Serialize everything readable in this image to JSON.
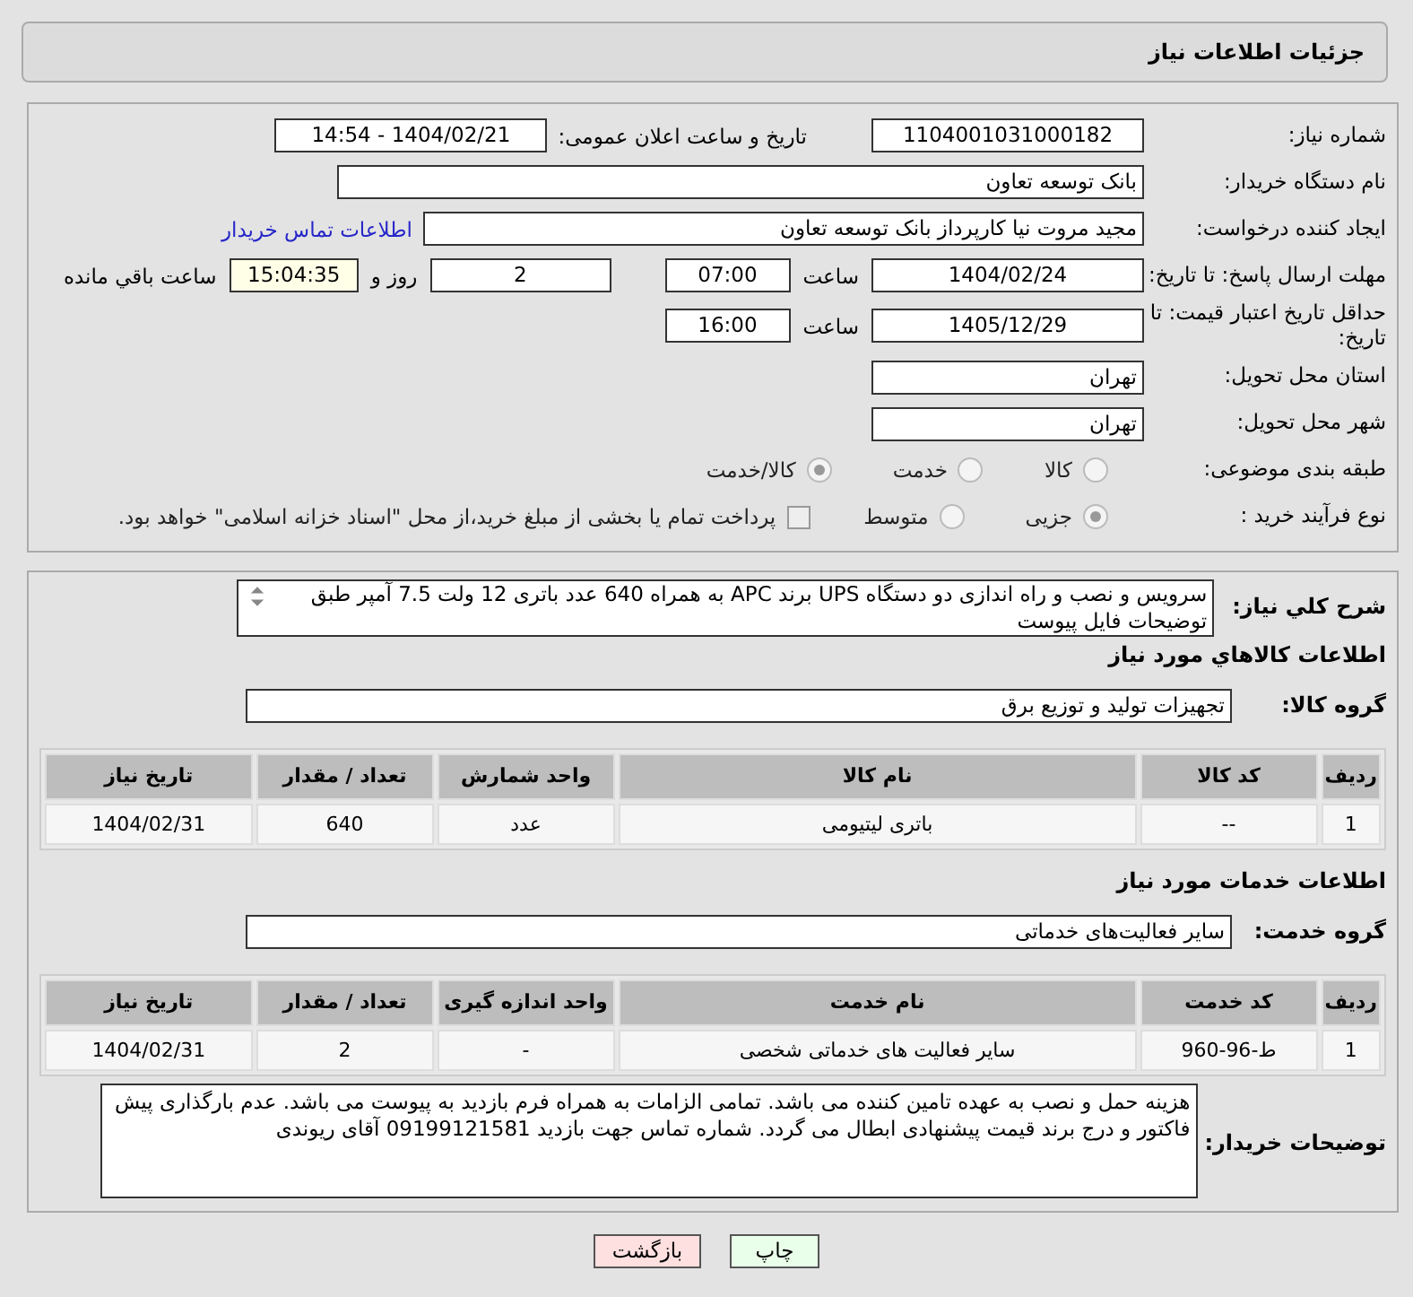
{
  "header": {
    "title": "جزئیات اطلاعات نیاز"
  },
  "form": {
    "need_number": {
      "label": "شماره نیاز:",
      "value": "1104001031000182"
    },
    "announce": {
      "label": "تاریخ و ساعت اعلان عمومی:",
      "value": "1404/02/21 - 14:54"
    },
    "buyer_org": {
      "label": "نام دستگاه خریدار:",
      "value": "بانک توسعه تعاون"
    },
    "requester": {
      "label": "ایجاد کننده درخواست:",
      "value": "مجید مروت نیا کارپرداز بانک توسعه تعاون",
      "link": "اطلاعات تماس خریدار"
    },
    "deadline": {
      "label": "مهلت ارسال پاسخ: تا تاریخ:",
      "date": "1404/02/24",
      "time_label": "ساعت",
      "time": "07:00",
      "days": "2",
      "days_label": "روز و",
      "remaining": "15:04:35",
      "remaining_label": "ساعت باقي مانده"
    },
    "validity": {
      "label": "حداقل تاریخ اعتبار قیمت: تا تاریخ:",
      "date": "1405/12/29",
      "time_label": "ساعت",
      "time": "16:00"
    },
    "province": {
      "label": "استان محل تحویل:",
      "value": "تهران"
    },
    "city": {
      "label": "شهر محل تحویل:",
      "value": "تهران"
    },
    "category": {
      "label": "طبقه بندی موضوعی:",
      "options": [
        {
          "label": "کالا",
          "selected": false
        },
        {
          "label": "خدمت",
          "selected": false
        },
        {
          "label": "کالا/خدمت",
          "selected": true
        }
      ]
    },
    "process": {
      "label": "نوع فرآیند خرید :",
      "options": [
        {
          "label": "جزیی",
          "selected": true
        },
        {
          "label": "متوسط",
          "selected": false
        }
      ],
      "payment": {
        "label": "پرداخت تمام یا بخشی از مبلغ خرید،از محل \"اسناد خزانه اسلامی\" خواهد بود.",
        "checked": false
      }
    }
  },
  "details": {
    "description": {
      "label": "شرح کلي نیاز:",
      "value": "سرویس و نصب و راه اندازی دو دستگاه UPS برند APC به همراه 640 عدد باتری 12 ولت 7.5 آمپر طبق توضیحات فایل پیوست"
    },
    "goods": {
      "heading": "اطلاعات کالاهاي مورد نیاز",
      "group_label": "گروه کالا:",
      "group": "تجهیزات تولید و توزیع برق",
      "columns": [
        "ردیف",
        "کد کالا",
        "نام کالا",
        "واحد شمارش",
        "تعداد / مقدار",
        "تاریخ نیاز"
      ],
      "rows": [
        [
          "1",
          "--",
          "باتری لیتیومی",
          "عدد",
          "640",
          "1404/02/31"
        ]
      ]
    },
    "services": {
      "heading": "اطلاعات خدمات مورد نیاز",
      "group_label": "گروه خدمت:",
      "group": "سایر فعالیت‌های خدماتی",
      "columns": [
        "ردیف",
        "کد خدمت",
        "نام خدمت",
        "واحد اندازه گیری",
        "تعداد / مقدار",
        "تاریخ نیاز"
      ],
      "rows": [
        [
          "1",
          "ط-96-960",
          "سایر فعالیت های خدماتی شخصی",
          "-",
          "2",
          "1404/02/31"
        ]
      ]
    }
  },
  "remarks": {
    "label": "توضیحات خریدار:",
    "value": "هزینه حمل و نصب به عهده تامین کننده می باشد. تمامی الزامات به همراه فرم بازدید به پیوست می باشد. عدم بارگذاری پیش فاکتور و درج برند قیمت پیشنهادی ابطال می گردد. شماره تماس جهت بازدید 09199121581 آقای ریوندی"
  },
  "buttons": [
    {
      "label": "چاپ",
      "kind": "print"
    },
    {
      "label": "بازگشت",
      "kind": "back"
    }
  ]
}
